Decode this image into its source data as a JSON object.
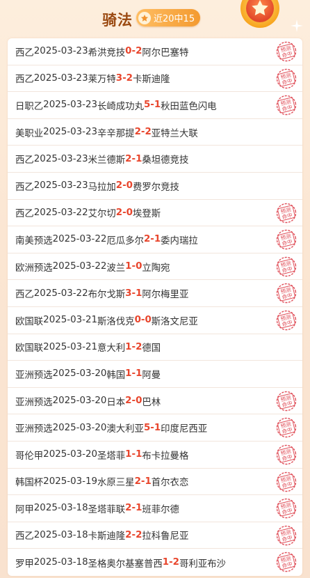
{
  "header": {
    "title": "骑法",
    "badge": "近20中15"
  },
  "stamp_text": [
    "预测",
    "命中"
  ],
  "matches": [
    {
      "league": "西乙",
      "date": "2025-03-23",
      "home": "希洪竞技",
      "home_score": "0",
      "away_score": "2",
      "away": "阿尔巴塞特",
      "hit": true
    },
    {
      "league": "西乙",
      "date": "2025-03-23",
      "home": "莱万特",
      "home_score": "3",
      "away_score": "2",
      "away": "卡斯迪隆",
      "hit": true
    },
    {
      "league": "日职乙",
      "date": "2025-03-23",
      "home": "长崎成功丸",
      "home_score": "5",
      "away_score": "1",
      "away": "秋田蓝色闪电",
      "hit": true
    },
    {
      "league": "美职业",
      "date": "2025-03-23",
      "home": "辛辛那提",
      "home_score": "2",
      "away_score": "2",
      "away": "亚特兰大联",
      "hit": false
    },
    {
      "league": "西乙",
      "date": "2025-03-23",
      "home": "米兰德斯",
      "home_score": "2",
      "away_score": "1",
      "away": "桑坦德竞技",
      "hit": false
    },
    {
      "league": "西乙",
      "date": "2025-03-23",
      "home": "马拉加",
      "home_score": "2",
      "away_score": "0",
      "away": "费罗尔竞技",
      "hit": false
    },
    {
      "league": "西乙",
      "date": "2025-03-22",
      "home": "艾尔切",
      "home_score": "2",
      "away_score": "0",
      "away": "埃登斯",
      "hit": true
    },
    {
      "league": "南美预选",
      "date": "2025-03-22",
      "home": "厄瓜多尔",
      "home_score": "2",
      "away_score": "1",
      "away": "委内瑞拉",
      "hit": true
    },
    {
      "league": "欧洲预选",
      "date": "2025-03-22",
      "home": "波兰",
      "home_score": "1",
      "away_score": "0",
      "away": "立陶宛",
      "hit": true
    },
    {
      "league": "西乙",
      "date": "2025-03-22",
      "home": "布尔戈斯",
      "home_score": "3",
      "away_score": "1",
      "away": "阿尔梅里亚",
      "hit": true
    },
    {
      "league": "欧国联",
      "date": "2025-03-21",
      "home": "斯洛伐克",
      "home_score": "0",
      "away_score": "0",
      "away": "斯洛文尼亚",
      "hit": true
    },
    {
      "league": "欧国联",
      "date": "2025-03-21",
      "home": "意大利",
      "home_score": "1",
      "away_score": "2",
      "away": "德国",
      "hit": false
    },
    {
      "league": "亚洲预选",
      "date": "2025-03-20",
      "home": "韩国",
      "home_score": "1",
      "away_score": "1",
      "away": "阿曼",
      "hit": false
    },
    {
      "league": "亚洲预选",
      "date": "2025-03-20",
      "home": "日本",
      "home_score": "2",
      "away_score": "0",
      "away": "巴林",
      "hit": true
    },
    {
      "league": "亚洲预选",
      "date": "2025-03-20",
      "home": "澳大利亚",
      "home_score": "5",
      "away_score": "1",
      "away": "印度尼西亚",
      "hit": true
    },
    {
      "league": "哥伦甲",
      "date": "2025-03-20",
      "home": "圣塔菲",
      "home_score": "1",
      "away_score": "1",
      "away": "布卡拉曼格",
      "hit": true
    },
    {
      "league": "韩国杯",
      "date": "2025-03-19",
      "home": "水原三星",
      "home_score": "2",
      "away_score": "1",
      "away": "首尔衣恋",
      "hit": true
    },
    {
      "league": "阿甲",
      "date": "2025-03-18",
      "home": "圣塔菲联",
      "home_score": "2",
      "away_score": "1",
      "away": "班菲尔德",
      "hit": true
    },
    {
      "league": "西乙",
      "date": "2025-03-18",
      "home": "卡斯迪隆",
      "home_score": "2",
      "away_score": "2",
      "away": "拉科鲁尼亚",
      "hit": true
    },
    {
      "league": "罗甲",
      "date": "2025-03-18",
      "home": "圣格奥尔基塞普西",
      "home_score": "1",
      "away_score": "2",
      "away": "哥利亚布沙",
      "hit": true
    }
  ],
  "colors": {
    "title": "#9b4a12",
    "score": "#e8452c",
    "badge": "#f39a30",
    "stamp": "#e0505a"
  }
}
